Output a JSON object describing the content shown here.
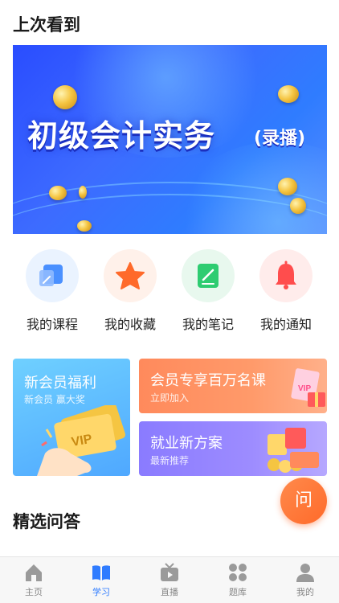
{
  "sections": {
    "recent_title": "上次看到",
    "qa_title": "精选问答"
  },
  "hero": {
    "title": "初级会计实务",
    "subtitle": "(录播)"
  },
  "quick_actions": [
    {
      "label": "我的课程",
      "icon": "course-icon",
      "color": "#4a90ff",
      "bg": "#eaf3ff"
    },
    {
      "label": "我的收藏",
      "icon": "star-icon",
      "color": "#ff6a2a",
      "bg": "#fff1ea"
    },
    {
      "label": "我的笔记",
      "icon": "note-icon",
      "color": "#2ecc71",
      "bg": "#e8f8ee"
    },
    {
      "label": "我的通知",
      "icon": "bell-icon",
      "color": "#ff4d4d",
      "bg": "#ffeceb"
    }
  ],
  "promos": {
    "new_member": {
      "title": "新会员福利",
      "subtitle": "新会员 赢大奖",
      "badge": "VIP"
    },
    "vip": {
      "title": "会员专享百万名课",
      "subtitle": "立即加入",
      "badge": "VIP"
    },
    "job": {
      "title": "就业新方案",
      "subtitle": "最新推荐"
    }
  },
  "ask_button": {
    "label": "问"
  },
  "tabs": [
    {
      "label": "主页",
      "icon": "home-icon",
      "active": false
    },
    {
      "label": "学习",
      "icon": "book-icon",
      "active": true
    },
    {
      "label": "直播",
      "icon": "tv-icon",
      "active": false
    },
    {
      "label": "题库",
      "icon": "grid-icon",
      "active": false
    },
    {
      "label": "我的",
      "icon": "user-icon",
      "active": false
    }
  ],
  "colors": {
    "accent": "#2f7cff",
    "inactive": "#9a9a9a",
    "orange": "#ff6a2a"
  }
}
